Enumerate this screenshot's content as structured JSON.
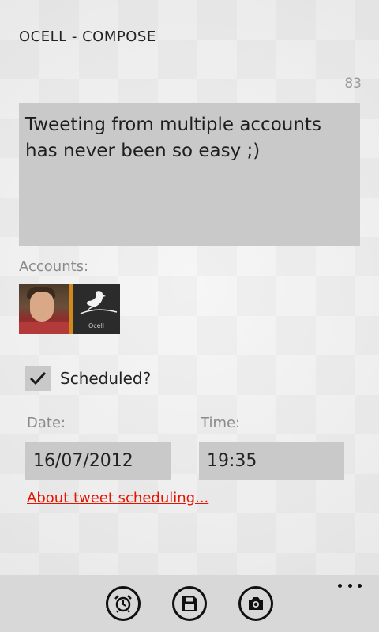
{
  "page": {
    "title": "OCELL - COMPOSE"
  },
  "compose": {
    "char_count": "83",
    "tweet_text": "Tweeting from multiple accounts has never been so easy ;)"
  },
  "accounts": {
    "label": "Accounts:",
    "items": [
      {
        "name": "user-avatar"
      },
      {
        "name": "ocell-account",
        "caption": "Ocell"
      }
    ]
  },
  "schedule": {
    "checkbox_label": "Scheduled?",
    "checked": true,
    "date_label": "Date:",
    "date_value": "16/07/2012",
    "time_label": "Time:",
    "time_value": "19:35",
    "about_link": "About tweet scheduling..."
  },
  "appbar": {
    "buttons": [
      {
        "icon": "alarm-clock-icon"
      },
      {
        "icon": "save-icon"
      },
      {
        "icon": "camera-icon"
      }
    ],
    "more": "more-icon"
  },
  "colors": {
    "accent": "#e51400",
    "field_bg": "#c9c9c9",
    "appbar_bg": "#d8d8d8"
  }
}
